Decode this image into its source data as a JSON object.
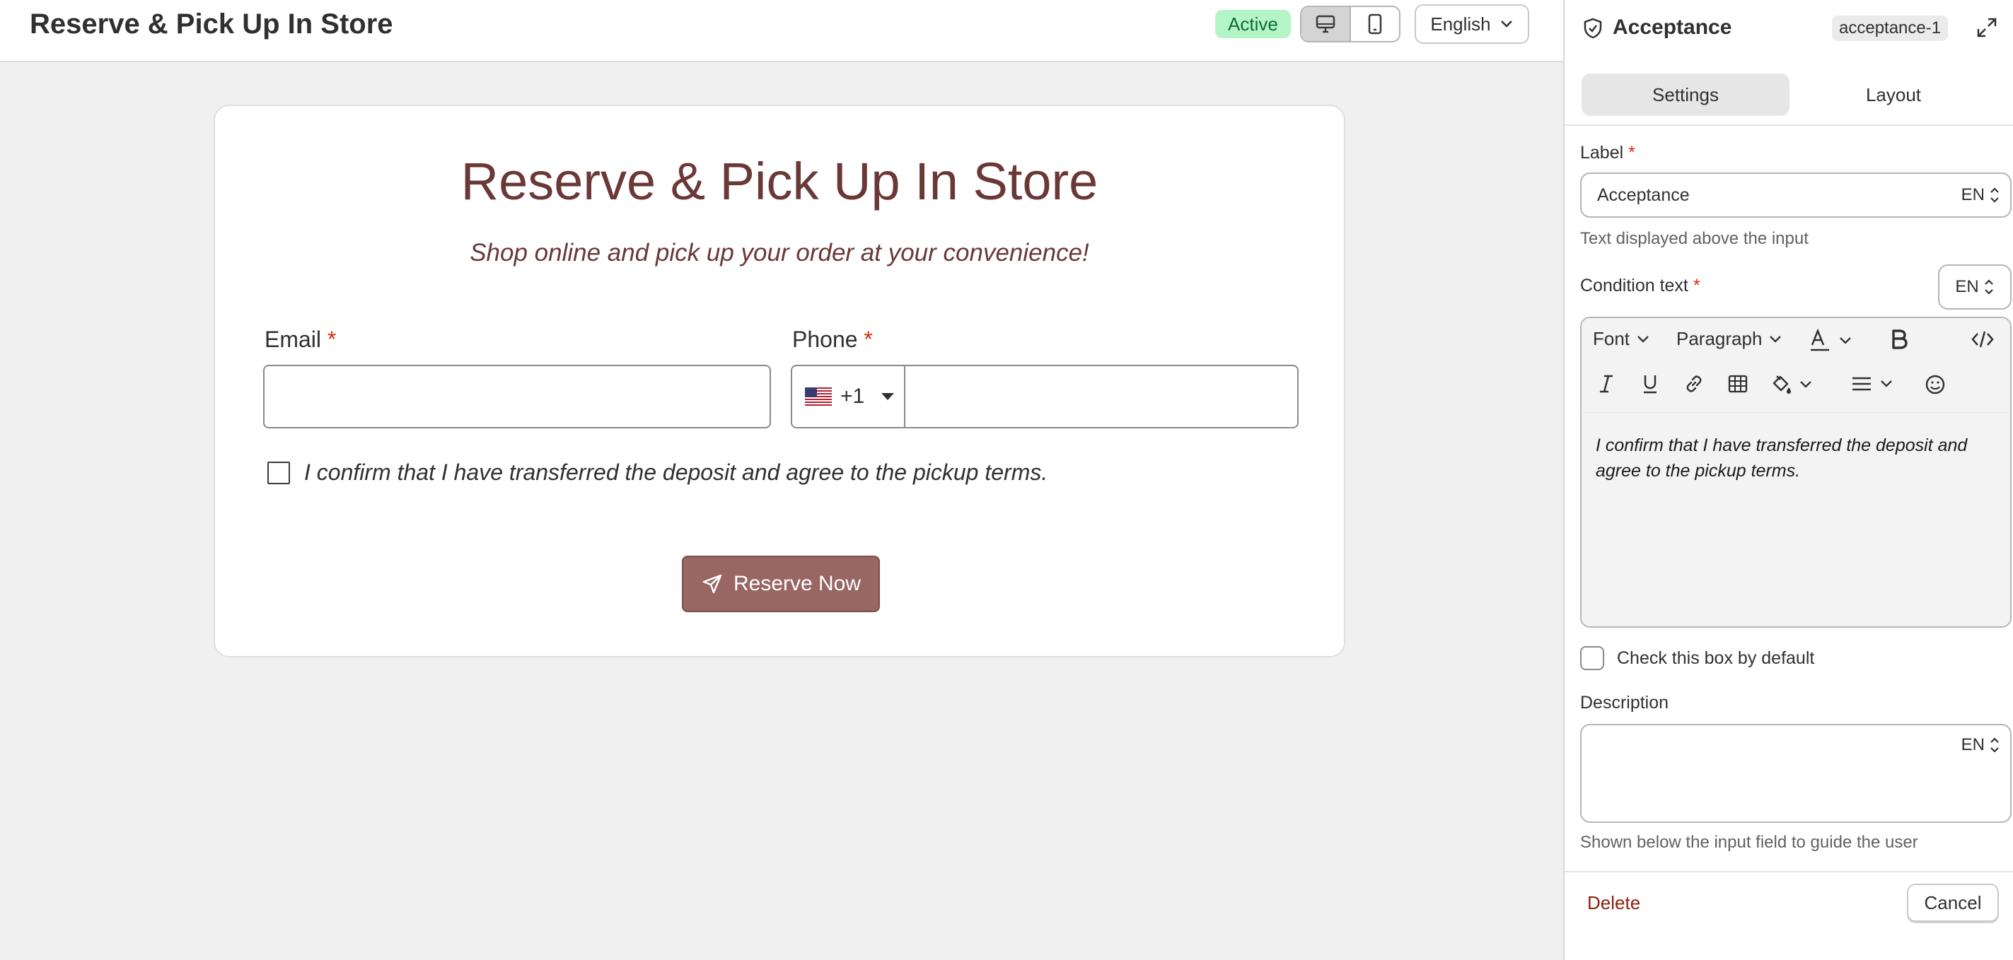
{
  "header": {
    "title": "Reserve & Pick Up In Store",
    "status": "Active",
    "language": "English"
  },
  "form": {
    "title": "Reserve & Pick Up In Store",
    "subtitle": "Shop online and pick up your order at your convenience!",
    "email_label": "Email",
    "phone_label": "Phone",
    "required_mark": "*",
    "country_code": "+1",
    "acceptance_text": "I confirm that I have transferred the deposit and agree to the pickup terms.",
    "submit_label": "Reserve Now"
  },
  "panel": {
    "title": "Acceptance",
    "id_chip": "acceptance-1",
    "tabs": [
      {
        "label": "Settings",
        "active": true
      },
      {
        "label": "Layout",
        "active": false
      }
    ],
    "label_field": {
      "label": "Label",
      "value": "Acceptance",
      "lang": "EN",
      "help": "Text displayed above the input"
    },
    "condition_field": {
      "label": "Condition text",
      "lang": "EN",
      "toolbar": {
        "font": "Font",
        "paragraph": "Paragraph"
      },
      "content": "I confirm that I have transferred the deposit and agree to the pickup terms."
    },
    "default_check_label": "Check this box by default",
    "description_field": {
      "label": "Description",
      "lang": "EN",
      "help": "Shown below the input field to guide the user"
    },
    "delete_label": "Delete",
    "cancel_label": "Cancel"
  },
  "colors": {
    "brand_title": "#6b3838",
    "button_bg": "#986663",
    "active_badge_bg": "#b4f5c8",
    "delete_text": "#8e1f0b",
    "required": "#d72c0d"
  },
  "icons": [
    "desktop-icon",
    "mobile-icon",
    "chevron-down-icon",
    "us-flag-icon",
    "caret-down-icon",
    "send-icon",
    "shield-check-icon",
    "expand-icon",
    "text-color-icon",
    "bold-icon",
    "code-icon",
    "italic-icon",
    "underline-icon",
    "link-icon",
    "table-icon",
    "fill-color-icon",
    "align-icon",
    "emoji-icon",
    "updown-chevron-icon"
  ]
}
